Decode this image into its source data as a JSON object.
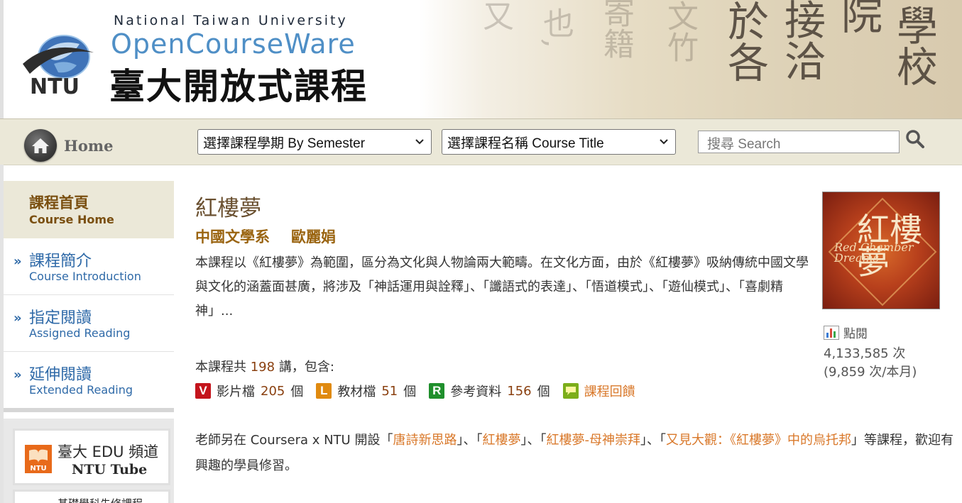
{
  "header": {
    "org_en": "National Taiwan University",
    "brand_en": "OpenCourseWare",
    "brand_zh": "臺大開放式課程",
    "logo_text": "NTU",
    "calligraphy": [
      "學校",
      "院",
      "接洽",
      "於各",
      "文竹",
      "寄籍",
      "也,",
      "又"
    ]
  },
  "nav": {
    "home_label": "Home",
    "semester_select": "選擇課程學期 By Semester",
    "course_select": "選擇課程名稱 Course Title",
    "search_placeholder": "搜尋 Search"
  },
  "sidebar": {
    "home": {
      "zh": "課程首頁",
      "en": "Course Home"
    },
    "items": [
      {
        "zh": "課程簡介",
        "en": "Course Introduction"
      },
      {
        "zh": "指定閱讀",
        "en": "Assigned Reading"
      },
      {
        "zh": "延伸閱讀",
        "en": "Extended Reading"
      }
    ],
    "edu_banner": {
      "line1": "臺大 EDU 頻道",
      "line2": "NTU Tube",
      "logo": "NTU"
    },
    "banner2_text": "基礎學科先修課程"
  },
  "course": {
    "title": "紅樓夢",
    "department": "中國文學系",
    "teacher": "歐麗娟",
    "description": "本課程以《紅樓夢》為範圍，區分為文化與人物論兩大範疇。在文化方面，由於《紅樓夢》吸納傳統中國文學與文化的涵蓋面甚廣，將涉及「神話運用與詮釋」、「讖語式的表達」、「悟道模式」、「遊仙模式」、「喜劇精神」...",
    "lectures_prefix": "本課程共",
    "lectures_count": "198",
    "lectures_suffix": "講，包含:",
    "materials": [
      {
        "badge": "V",
        "label": "影片檔",
        "count": "205",
        "unit": "個"
      },
      {
        "badge": "L",
        "label": "教材檔",
        "count": "51",
        "unit": "個"
      },
      {
        "badge": "R",
        "label": "參考資料",
        "count": "156",
        "unit": "個"
      }
    ],
    "feedback_label": "課程回饋",
    "coursera": {
      "prefix": "老師另在 Coursera x NTU 開設「",
      "link1": "唐詩新思路",
      "sep1": "」、「",
      "link2": "紅樓夢",
      "sep2": "」、「",
      "link3": "紅樓夢-母神崇拜",
      "sep3": "」、「",
      "link4": "又見大觀：《紅樓夢》中的烏托邦",
      "suffix": "」等課程，歡迎有興趣的學員修習。"
    }
  },
  "cover": {
    "zh": "紅樓夢",
    "en": "Red Chamber Dreams"
  },
  "stats": {
    "label": "點閱",
    "total": "4,133,585 次",
    "monthly": "(9,859 次/本月)"
  },
  "colors": {
    "accent_brown": "#9a6410",
    "link_blue": "#2f6aa8",
    "link_orange": "#d9782a",
    "nav_bg": "#ebe8d8"
  }
}
